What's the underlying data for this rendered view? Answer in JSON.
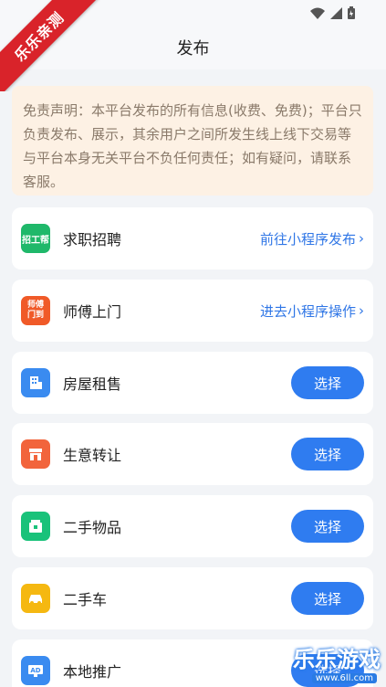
{
  "ribbon": "乐乐亲测",
  "nav": {
    "title": "发布"
  },
  "notice": {
    "text": "免责声明：本平台发布的所有信息(收费、免费)；平台只负责发布、展示，其余用户之间所发生线上线下交易等与平台本身无关平台不负任何责任；如有疑问，请联系客服。"
  },
  "items": [
    {
      "label": "求职招聘",
      "icon": "zhaogongbang-icon",
      "icon_text": "招工帮",
      "icon_color": "#1fb86a",
      "action_type": "link",
      "action": "前往小程序发布"
    },
    {
      "label": "师傅上门",
      "icon": "shifu-icon",
      "icon_text": "师傅门到",
      "icon_color": "#f05a28",
      "action_type": "link",
      "action": "进去小程序操作"
    },
    {
      "label": "房屋租售",
      "icon": "building-icon",
      "icon_color": "#3a8bf0",
      "action_type": "button",
      "action": "选择"
    },
    {
      "label": "生意转让",
      "icon": "shop-icon",
      "icon_color": "#f2643c",
      "action_type": "button",
      "action": "选择"
    },
    {
      "label": "二手物品",
      "icon": "package-icon",
      "icon_color": "#19c27a",
      "action_type": "button",
      "action": "选择"
    },
    {
      "label": "二手车",
      "icon": "car-icon",
      "icon_color": "#f5b811",
      "action_type": "button",
      "action": "选择"
    },
    {
      "label": "本地推广",
      "icon": "ad-icon",
      "icon_color": "#3a8bf0",
      "action_type": "button",
      "action": "选择"
    }
  ],
  "watermark": {
    "main": "乐乐游戏",
    "url": "www.6ll.com"
  },
  "colors": {
    "accent": "#2f7cf0",
    "notice_bg": "#fdf1e4",
    "link": "#2f76e6"
  }
}
